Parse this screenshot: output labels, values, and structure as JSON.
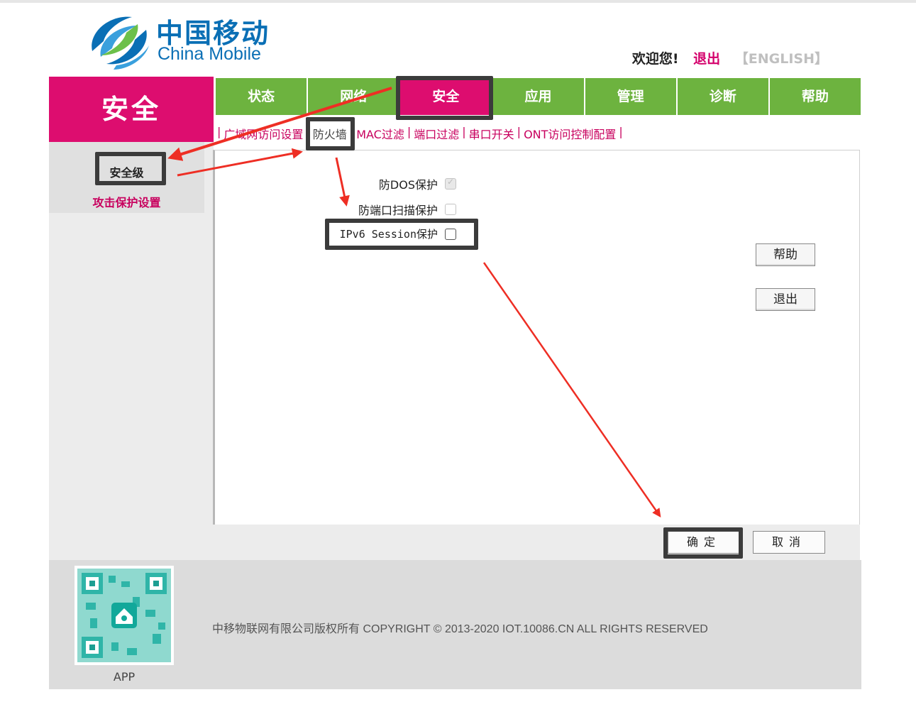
{
  "brand": {
    "name_cn": "中国移动",
    "name_en": "China Mobile",
    "color": "#0a6fb5"
  },
  "header": {
    "welcome": "欢迎您!",
    "logout": "退出",
    "english": "【ENGLISH】"
  },
  "section": {
    "title": "安全",
    "color": "#dd0d6f"
  },
  "nav": {
    "items": [
      {
        "label": "状态"
      },
      {
        "label": "网络"
      },
      {
        "label": "安全"
      },
      {
        "label": "应用"
      },
      {
        "label": "管理"
      },
      {
        "label": "诊断"
      },
      {
        "label": "帮助"
      }
    ],
    "active_label": "安全",
    "color": "#6db33f"
  },
  "subnav": {
    "items": [
      {
        "label": "广域网访问设置"
      },
      {
        "label": "防火墙"
      },
      {
        "label": "MAC过滤"
      },
      {
        "label": "端口过滤"
      },
      {
        "label": "串口开关"
      },
      {
        "label": "ONT访问控制配置"
      }
    ],
    "separator": "|",
    "current_label": "防火墙"
  },
  "leftmenu": {
    "items": [
      {
        "label": "安全级"
      },
      {
        "label": "攻击保护设置"
      }
    ]
  },
  "options": [
    {
      "label": "防DOS保护",
      "checked": true,
      "disabled": true
    },
    {
      "label": "防端口扫描保护",
      "checked": false,
      "disabled": true
    },
    {
      "label": "IPv6 Session保护",
      "checked": false,
      "disabled": false
    }
  ],
  "side_buttons": {
    "help": "帮助",
    "logout": "退出"
  },
  "form_buttons": {
    "confirm": "确定",
    "cancel": "取消"
  },
  "footer": {
    "copyright": "中移物联网有限公司版权所有 COPYRIGHT © 2013-2020 IOT.10086.CN ALL RIGHTS RESERVED",
    "qr_label": "APP"
  },
  "annotation_color": "#ee2e24"
}
